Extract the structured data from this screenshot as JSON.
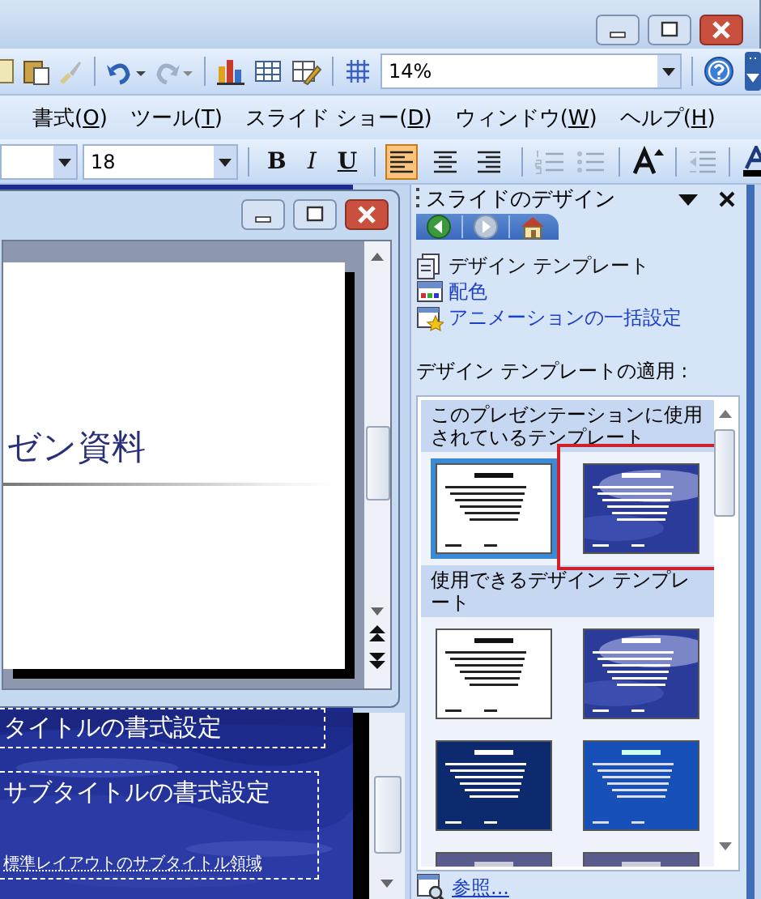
{
  "toolbar": {
    "zoom": "14%"
  },
  "menu": [
    {
      "before": "書式(",
      "key": "O",
      "after": ")"
    },
    {
      "before": "ツール(",
      "key": "T",
      "after": ")"
    },
    {
      "before": "スライド ショー(",
      "key": "D",
      "after": ")"
    },
    {
      "before": "ウィンドウ(",
      "key": "W",
      "after": ")"
    },
    {
      "before": "ヘルプ(",
      "key": "H",
      "after": ")"
    }
  ],
  "format_toolbar": {
    "font_size": "18",
    "styles": [
      {
        "label": "B",
        "kind": "bold"
      },
      {
        "label": "I",
        "kind": "italic"
      },
      {
        "label": "U",
        "kind": "underline"
      }
    ],
    "alignment": [
      {
        "kind": "left",
        "selected": true
      },
      {
        "kind": "center",
        "selected": false
      },
      {
        "kind": "right",
        "selected": false
      }
    ]
  },
  "document_window": {
    "slide_title": "ゼン資料"
  },
  "master_slide": {
    "title": "タイトルの書式設定",
    "subtitle": "サブタイトルの書式設定",
    "footer": "標準レイアウトのサブタイトル領域"
  },
  "task_pane": {
    "title": "スライドのデザイン",
    "options": [
      {
        "label": "デザイン テンプレート",
        "kind": "template",
        "selected": true
      },
      {
        "label": "配色",
        "kind": "colors",
        "selected": false
      },
      {
        "label": "アニメーションの一括設定",
        "kind": "animation",
        "selected": false
      }
    ],
    "apply_label": "デザイン テンプレートの適用 :",
    "groups": [
      {
        "heading": "このプレゼンテーションに使用されているテンプレート",
        "templates": [
          {
            "kind": "white",
            "selected": true,
            "marked": false
          },
          {
            "kind": "sky",
            "selected": false,
            "marked": true
          }
        ]
      },
      {
        "heading": "使用できるデザイン テンプレート",
        "templates": [
          {
            "kind": "white",
            "selected": false,
            "marked": false
          },
          {
            "kind": "sky",
            "selected": false,
            "marked": false
          },
          {
            "kind": "navy",
            "selected": false,
            "marked": false
          },
          {
            "kind": "blue",
            "selected": false,
            "marked": false
          },
          {
            "kind": "slate",
            "selected": false,
            "marked": false
          },
          {
            "kind": "slate",
            "selected": false,
            "marked": false
          }
        ]
      }
    ],
    "browse": "参照..."
  }
}
